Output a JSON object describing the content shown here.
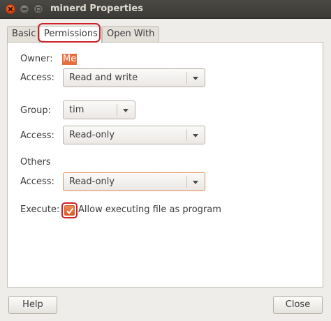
{
  "window": {
    "title": "minerd Properties"
  },
  "tabs": [
    {
      "label": "Basic"
    },
    {
      "label": "Permissions"
    },
    {
      "label": "Open With"
    }
  ],
  "permissions": {
    "owner_label": "Owner:",
    "owner_value": "Me",
    "owner_access_label": "Access:",
    "owner_access_value": "Read and write",
    "group_label": "Group:",
    "group_value": "tim",
    "group_access_label": "Access:",
    "group_access_value": "Read-only",
    "others_label": "Others",
    "others_access_label": "Access:",
    "others_access_value": "Read-only",
    "execute_label": "Execute:",
    "execute_checkbox_label": "Allow executing file as program",
    "execute_checked": true
  },
  "buttons": {
    "help": "Help",
    "close": "Close"
  },
  "colors": {
    "accent": "#dd4814",
    "highlight_annotation": "#d0202a",
    "titlebar": "#3c3b37"
  }
}
